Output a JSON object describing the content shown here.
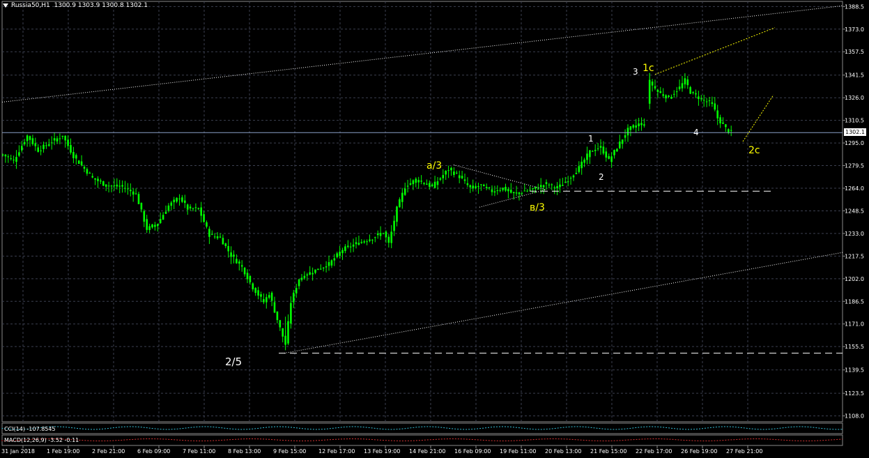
{
  "header": {
    "symbol": "Russia50,H1",
    "ohlc": "1300.9 1303.9 1300.8 1302.1"
  },
  "colors": {
    "background": "#000000",
    "grid": "#3c4050",
    "candle": "#00ff00",
    "labels_yellow": "#ffff00",
    "labels_white": "#ffffff",
    "current_price_line": "#8aa0c8"
  },
  "price_axis": {
    "ticks": [
      "1388.5",
      "1373.0",
      "1357.5",
      "1341.5",
      "1326.0",
      "1310.5",
      "1295.0",
      "1279.5",
      "1264.0",
      "1248.5",
      "1233.0",
      "1217.5",
      "1202.0",
      "1186.5",
      "1171.0",
      "1155.5",
      "1139.5",
      "1123.5",
      "1108.0"
    ],
    "current_price": "1302.1"
  },
  "time_axis": {
    "labels": [
      "31 Jan 2018",
      "1 Feb 19:00",
      "2 Feb 21:00",
      "6 Feb 09:00",
      "7 Feb 11:00",
      "8 Feb 13:00",
      "9 Feb 15:00",
      "12 Feb 17:00",
      "13 Feb 19:00",
      "14 Feb 21:00",
      "16 Feb 09:00",
      "19 Feb 11:00",
      "20 Feb 13:00",
      "21 Feb 15:00",
      "22 Feb 17:00",
      "26 Feb 19:00",
      "27 Feb 21:00"
    ]
  },
  "indicators": {
    "cci_label": "CCI(14) -107.8545",
    "macd_label": "MACD(12,26,9) -3.52 -0.11"
  },
  "annotations": {
    "a3": "a/3",
    "b3": "в/3",
    "wave_2_5": "2/5",
    "w1": "1",
    "w2": "2",
    "w3": "3",
    "w1c": "1c",
    "w4": "4",
    "w2c": "2c"
  },
  "chart_data": {
    "type": "candlestick",
    "ylim": [
      1104,
      1392
    ],
    "anchors": [
      [
        0,
        1287
      ],
      [
        4,
        1283
      ],
      [
        9,
        1300
      ],
      [
        13,
        1290
      ],
      [
        18,
        1296
      ],
      [
        22,
        1300
      ],
      [
        26,
        1286
      ],
      [
        33,
        1271
      ],
      [
        38,
        1266
      ],
      [
        44,
        1265
      ],
      [
        49,
        1260
      ],
      [
        53,
        1236
      ],
      [
        57,
        1240
      ],
      [
        61,
        1252
      ],
      [
        65,
        1258
      ],
      [
        68,
        1250
      ],
      [
        72,
        1250
      ],
      [
        76,
        1232
      ],
      [
        80,
        1230
      ],
      [
        84,
        1218
      ],
      [
        88,
        1210
      ],
      [
        92,
        1196
      ],
      [
        96,
        1186
      ],
      [
        98,
        1192
      ],
      [
        102,
        1168
      ],
      [
        104,
        1157
      ],
      [
        106,
        1186
      ],
      [
        109,
        1202
      ],
      [
        114,
        1207
      ],
      [
        120,
        1212
      ],
      [
        125,
        1222
      ],
      [
        130,
        1226
      ],
      [
        136,
        1230
      ],
      [
        140,
        1234
      ],
      [
        142,
        1226
      ],
      [
        145,
        1250
      ],
      [
        148,
        1265
      ],
      [
        152,
        1270
      ],
      [
        158,
        1265
      ],
      [
        164,
        1277
      ],
      [
        168,
        1272
      ],
      [
        172,
        1264
      ],
      [
        176,
        1266
      ],
      [
        180,
        1262
      ],
      [
        184,
        1264
      ],
      [
        188,
        1260
      ],
      [
        192,
        1262
      ],
      [
        196,
        1264
      ],
      [
        200,
        1267
      ],
      [
        204,
        1264
      ],
      [
        208,
        1270
      ],
      [
        212,
        1278
      ],
      [
        216,
        1289
      ],
      [
        220,
        1292
      ],
      [
        223,
        1283
      ],
      [
        226,
        1292
      ],
      [
        230,
        1304
      ],
      [
        234,
        1308
      ],
      [
        236,
        1308
      ],
      [
        238,
        1337
      ],
      [
        241,
        1330
      ],
      [
        245,
        1326
      ],
      [
        249,
        1333
      ],
      [
        251,
        1338
      ],
      [
        253,
        1330
      ],
      [
        257,
        1325
      ],
      [
        261,
        1322
      ],
      [
        263,
        1312
      ],
      [
        266,
        1305
      ],
      [
        268,
        1302
      ]
    ],
    "gaps": [
      [
        236,
        238
      ]
    ]
  }
}
